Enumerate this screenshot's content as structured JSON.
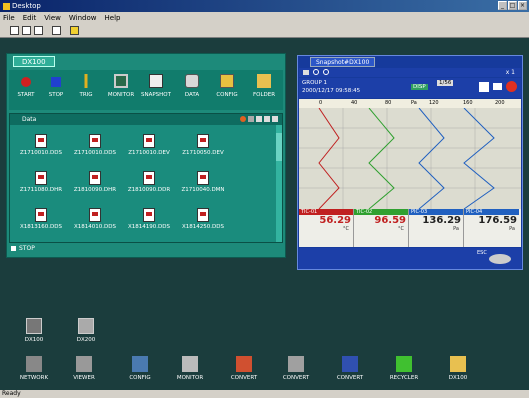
{
  "window": {
    "title": "Desktop",
    "controls": [
      "_",
      "□",
      "×"
    ]
  },
  "menu": [
    "File",
    "Edit",
    "View",
    "Window",
    "Help"
  ],
  "dx": {
    "tab": "DX100",
    "buttons": [
      "START",
      "STOP",
      "TRIG",
      "MONITOR",
      "SNAPSHOT",
      "DATA",
      "CONFIG",
      "FOLDER"
    ],
    "data_label": "Data",
    "files": [
      "Z1710010.DDS",
      "Z1710010.DDS",
      "Z1710010.DEV",
      "Z1710050.DEV",
      "Z1711080.DHR",
      "Z1810090.DHR",
      "Z1810090.DDR",
      "Z1710040.DMN",
      "X1813160.DDS",
      "X1814010.DDS",
      "X1814190.DDS",
      "X1814250.DDS"
    ],
    "status": "STOP"
  },
  "snapshot": {
    "tab": "Snapshot#DX100",
    "zoom": "x 1",
    "group": "GROUP 1",
    "datetime": "2000/12/17 09:58:45",
    "disp": "DISP",
    "page": "1/56",
    "scale": [
      "0",
      "40",
      "80",
      "Pa",
      "120",
      "160",
      "200"
    ],
    "channels": [
      {
        "tag": "TIC-01",
        "mark": "H",
        "value": "56.29",
        "unit": "°C",
        "color": "#c02020"
      },
      {
        "tag": "TIC-02",
        "mark": "R",
        "value": "96.59",
        "unit": "°C",
        "color": "#30a030"
      },
      {
        "tag": "PIC-03",
        "mark": "",
        "value": "136.29",
        "unit": "Pa",
        "color": "#2060c0"
      },
      {
        "tag": "PIC-04",
        "mark": "",
        "value": "176.59",
        "unit": "Pa",
        "color": "#2060c0"
      }
    ],
    "esc": "ESC"
  },
  "desktop_icons": [
    "DX100",
    "DX200"
  ],
  "taskbar": [
    "NETWORK",
    "VIEWER",
    "CONFIG",
    "MONITOR",
    "CONVERT",
    "CONVERT",
    "CONVERT",
    "RECYCLER",
    "DX100"
  ],
  "status": "Ready"
}
